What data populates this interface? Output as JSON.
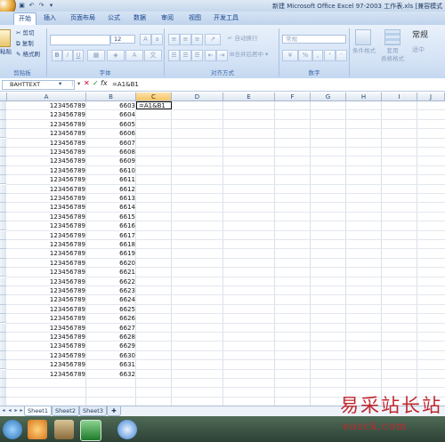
{
  "window": {
    "title": "新建 Microsoft Office Excel 97-2003 工作表.xls [兼容模式"
  },
  "tabs": [
    "开始",
    "插入",
    "页面布局",
    "公式",
    "数据",
    "审阅",
    "视图",
    "开发工具"
  ],
  "ribbon": {
    "paste_label": "粘贴",
    "cut_label": "剪切",
    "copy_label": "复制",
    "format_painter_label": "格式刷",
    "font_size": "12",
    "wrap_text_label": "自动换行",
    "merge_center_label": "合并后居中",
    "number_format": "常规",
    "percent_label": "%",
    "comma_label": ",",
    "cond_format_label": "条件格式",
    "table_format_label": "套用\n表格格式",
    "style_normal": "常规",
    "style_medium": "适中",
    "group_clipboard": "剪贴板",
    "group_font": "字体",
    "group_alignment": "对齐方式",
    "group_number": "数字"
  },
  "formula_bar": {
    "name_box": "BAHTTEXT",
    "content": "=A1&B1"
  },
  "columns": [
    "A",
    "B",
    "C",
    "D",
    "E",
    "F",
    "G",
    "H",
    "I",
    "J"
  ],
  "selected_column": "C",
  "active_cell": {
    "ref": "C1",
    "value": "=A1&B1"
  },
  "rows": [
    {
      "a": "123456789",
      "b": "6603"
    },
    {
      "a": "123456789",
      "b": "6604"
    },
    {
      "a": "123456789",
      "b": "6605"
    },
    {
      "a": "123456789",
      "b": "6606"
    },
    {
      "a": "123456789",
      "b": "6607"
    },
    {
      "a": "123456789",
      "b": "6608"
    },
    {
      "a": "123456789",
      "b": "6609"
    },
    {
      "a": "123456789",
      "b": "6610"
    },
    {
      "a": "123456789",
      "b": "6611"
    },
    {
      "a": "123456789",
      "b": "6612"
    },
    {
      "a": "123456789",
      "b": "6613"
    },
    {
      "a": "123456789",
      "b": "6614"
    },
    {
      "a": "123456789",
      "b": "6615"
    },
    {
      "a": "123456789",
      "b": "6616"
    },
    {
      "a": "123456789",
      "b": "6617"
    },
    {
      "a": "123456789",
      "b": "6618"
    },
    {
      "a": "123456789",
      "b": "6619"
    },
    {
      "a": "123456789",
      "b": "6620"
    },
    {
      "a": "123456789",
      "b": "6621"
    },
    {
      "a": "123456789",
      "b": "6622"
    },
    {
      "a": "123456789",
      "b": "6623"
    },
    {
      "a": "123456789",
      "b": "6624"
    },
    {
      "a": "123456789",
      "b": "6625"
    },
    {
      "a": "123456789",
      "b": "6626"
    },
    {
      "a": "123456789",
      "b": "6627"
    },
    {
      "a": "123456789",
      "b": "6628"
    },
    {
      "a": "123456789",
      "b": "6629"
    },
    {
      "a": "123456789",
      "b": "6630"
    },
    {
      "a": "123456789",
      "b": "6631"
    },
    {
      "a": "123456789",
      "b": "6632"
    }
  ],
  "sheets": [
    "Sheet1",
    "Sheet2",
    "Sheet3"
  ],
  "watermark": {
    "line1": "易采站长站",
    "line2": "easck.com"
  },
  "colors": {
    "accent": "#15428b",
    "selected_header": "#f4c468",
    "watermark": "#c0272d"
  }
}
